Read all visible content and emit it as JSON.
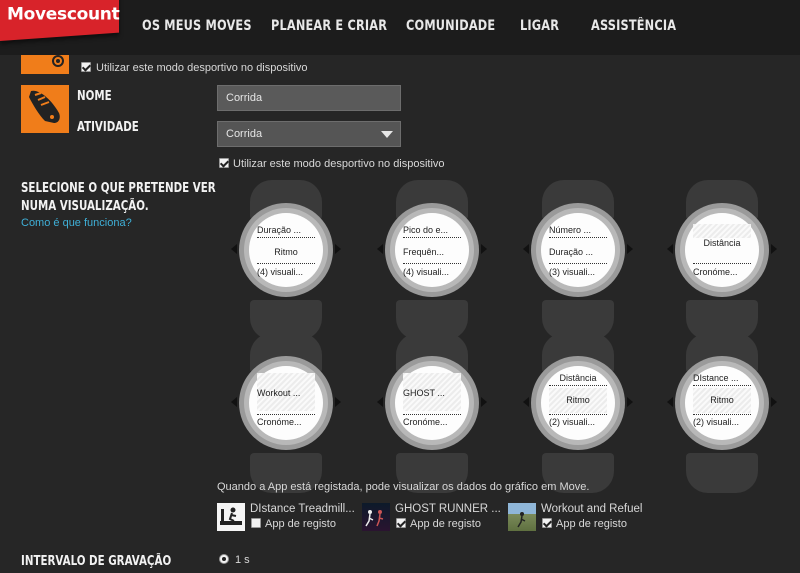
{
  "nav": {
    "logo": "Movescount",
    "items": [
      "OS MEUS MOVES",
      "PLANEAR E CRIAR",
      "COMUNIDADE",
      "LIGAR",
      "ASSISTÊNCIA"
    ]
  },
  "prev_mode": {
    "checkbox_label": "Utilizar este modo desportivo no dispositivo"
  },
  "mode": {
    "name_label": "NOME",
    "activity_label": "ATIVIDADE",
    "name_value": "Corrida",
    "activity_value": "Corrida",
    "checkbox_label": "Utilizar este modo desportivo no dispositivo"
  },
  "views": {
    "heading_line1": "SELECIONE O QUE PRETENDE VER",
    "heading_line2": "NUMA VISUALIZAÇÃO.",
    "help_link": "Como é que funciona?"
  },
  "watches": [
    {
      "top": "Duração ...",
      "mid": "Ritmo",
      "bottom": "(4) visuali..."
    },
    {
      "top": "Pico do e...",
      "mid": "Frequên...",
      "bottom": "(4) visuali..."
    },
    {
      "top": "Número ...",
      "mid": "Duração ...",
      "bottom": "(3) visuali..."
    },
    {
      "top": "",
      "mid": "Distância",
      "bottom": "Cronóme..."
    },
    {
      "top": "",
      "mid": "Workout ...",
      "bottom": "Cronóme..."
    },
    {
      "top": "",
      "mid": "GHOST ...",
      "bottom": "Cronóme..."
    },
    {
      "top": "Distância",
      "mid": "Ritmo",
      "bottom": "(2) visuali..."
    },
    {
      "top": "DIstance ...",
      "mid": "Ritmo",
      "bottom": "(2) visuali..."
    }
  ],
  "apps": {
    "note": "Quando a App está registada, pode visualizar os dados do gráfico em Move.",
    "items": [
      {
        "title": "DIstance Treadmill...",
        "check_label": "App de registo",
        "checked": false
      },
      {
        "title": "GHOST RUNNER ...",
        "check_label": "App de registo",
        "checked": true
      },
      {
        "title": "Workout and Refuel",
        "check_label": "App de registo",
        "checked": true
      }
    ]
  },
  "interval": {
    "label": "INTERVALO DE GRAVAÇÃO",
    "option": "1 s"
  },
  "colors": {
    "brand": "#d8232a",
    "accent": "#f07d1a",
    "link": "#3fb0d8"
  }
}
